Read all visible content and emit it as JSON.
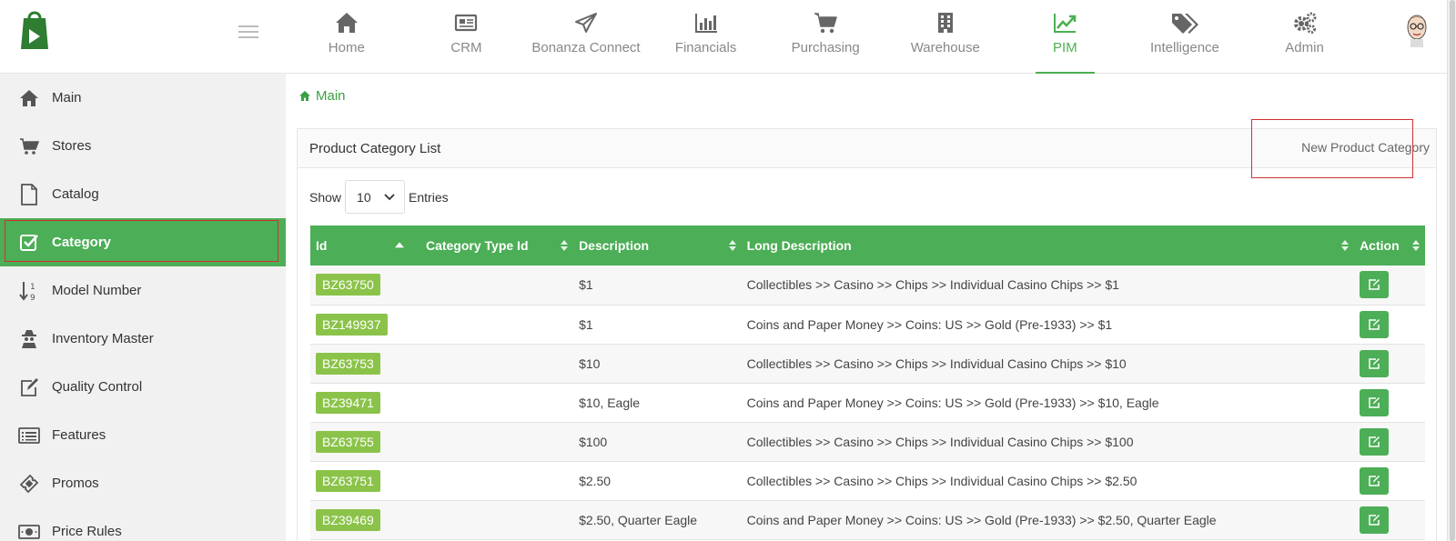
{
  "nav": {
    "items": [
      {
        "label": "Home",
        "icon": "home-icon"
      },
      {
        "label": "CRM",
        "icon": "newspaper-icon"
      },
      {
        "label": "Bonanza Connect",
        "icon": "paper-plane-icon"
      },
      {
        "label": "Financials",
        "icon": "bar-chart-icon"
      },
      {
        "label": "Purchasing",
        "icon": "cart-icon"
      },
      {
        "label": "Warehouse",
        "icon": "building-icon"
      },
      {
        "label": "PIM",
        "icon": "line-chart-icon"
      },
      {
        "label": "Intelligence",
        "icon": "tags-icon"
      },
      {
        "label": "Admin",
        "icon": "gears-icon"
      }
    ],
    "active": "PIM"
  },
  "sidebar": {
    "items": [
      {
        "label": "Main",
        "icon": "home-icon"
      },
      {
        "label": "Stores",
        "icon": "cart-icon"
      },
      {
        "label": "Catalog",
        "icon": "file-icon"
      },
      {
        "label": "Category",
        "icon": "checkbox-icon"
      },
      {
        "label": "Model Number",
        "icon": "sort-numeric-icon"
      },
      {
        "label": "Inventory Master",
        "icon": "user-secret-icon"
      },
      {
        "label": "Quality Control",
        "icon": "edit-icon"
      },
      {
        "label": "Features",
        "icon": "list-icon"
      },
      {
        "label": "Promos",
        "icon": "ticket-icon"
      },
      {
        "label": "Price Rules",
        "icon": "money-icon"
      }
    ],
    "active": "Category"
  },
  "breadcrumb": {
    "label": "Main"
  },
  "panel": {
    "title": "Product Category List",
    "new_button": "New Product Category",
    "show_label": "Show",
    "entries_value": "10",
    "entries_label": "Entries"
  },
  "table": {
    "headers": [
      "Id",
      "Category Type Id",
      "Description",
      "Long Description",
      "Action"
    ],
    "rows": [
      {
        "id": "BZ63750",
        "type_id": "",
        "description": "$1",
        "long_description": "Collectibles >> Casino >> Chips >> Individual Casino Chips >> $1"
      },
      {
        "id": "BZ149937",
        "type_id": "",
        "description": "$1",
        "long_description": "Coins and Paper Money >> Coins: US >> Gold (Pre-1933) >> $1"
      },
      {
        "id": "BZ63753",
        "type_id": "",
        "description": "$10",
        "long_description": "Collectibles >> Casino >> Chips >> Individual Casino Chips >> $10"
      },
      {
        "id": "BZ39471",
        "type_id": "",
        "description": "$10, Eagle",
        "long_description": "Coins and Paper Money >> Coins: US >> Gold (Pre-1933) >> $10, Eagle"
      },
      {
        "id": "BZ63755",
        "type_id": "",
        "description": "$100",
        "long_description": "Collectibles >> Casino >> Chips >> Individual Casino Chips >> $100"
      },
      {
        "id": "BZ63751",
        "type_id": "",
        "description": "$2.50",
        "long_description": "Collectibles >> Casino >> Chips >> Individual Casino Chips >> $2.50"
      },
      {
        "id": "BZ39469",
        "type_id": "",
        "description": "$2.50, Quarter Eagle",
        "long_description": "Coins and Paper Money >> Coins: US >> Gold (Pre-1933) >> $2.50, Quarter Eagle"
      }
    ]
  },
  "colors": {
    "accent": "#4cae56",
    "badge": "#8bc34a",
    "highlight": "#d32f2f"
  }
}
